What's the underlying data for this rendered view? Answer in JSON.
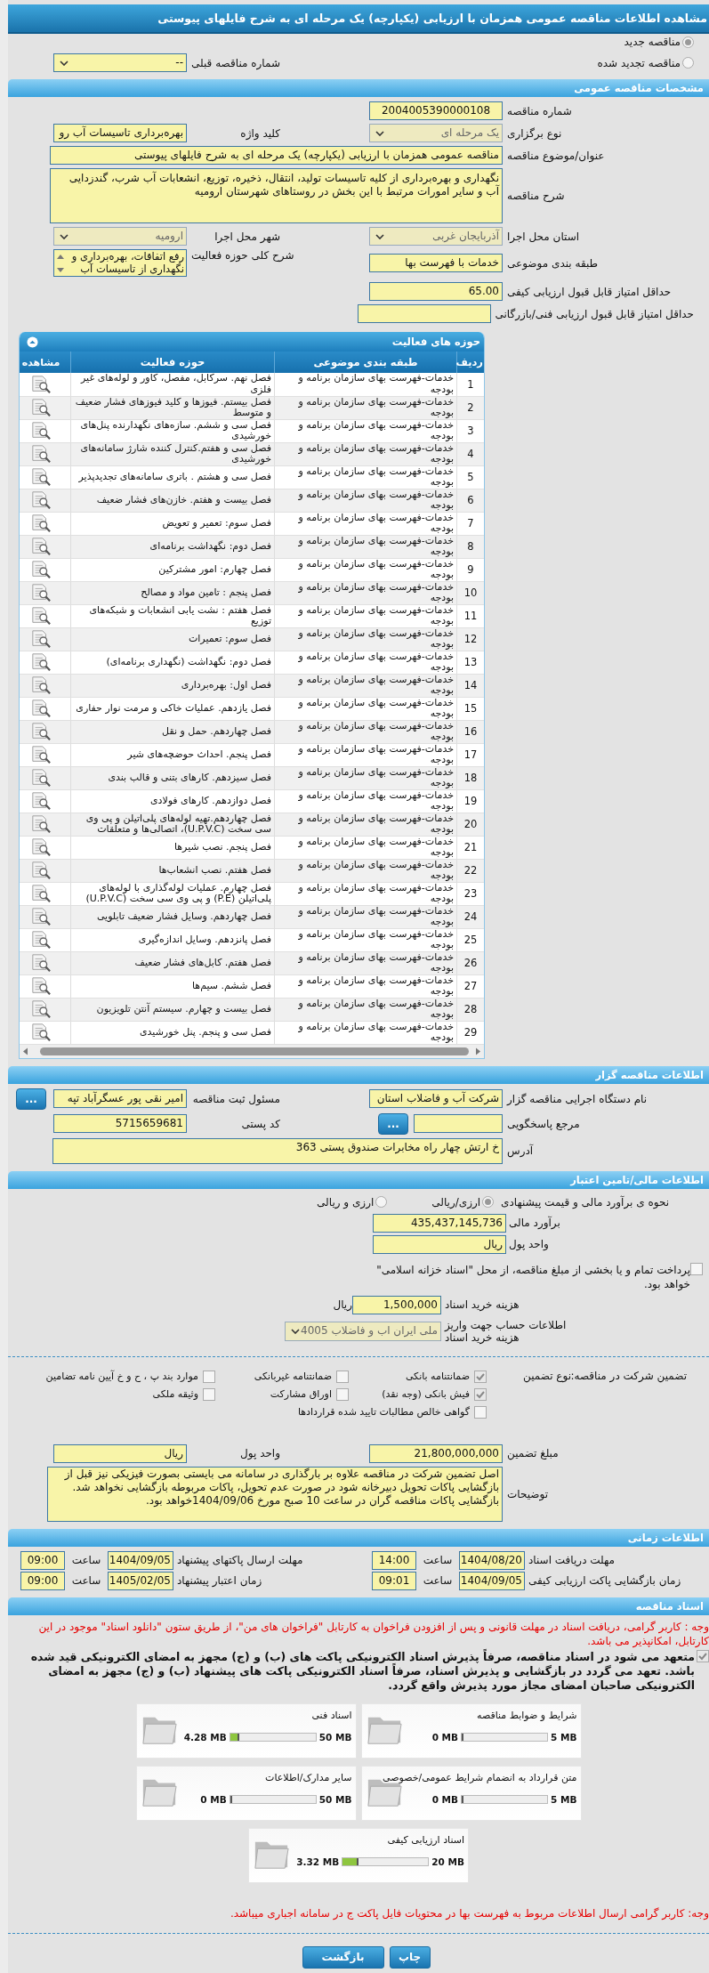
{
  "page_title": "مشاهده اطلاعات مناقصه عمومی همزمان با ارزیابی (یکپارچه) یک مرحله ای به شرح فایلهای پیوستی",
  "tender_type": [
    {
      "label": "مناقصه جدید",
      "selected": true
    },
    {
      "label": "مناقصه تجدید شده",
      "selected": false
    }
  ],
  "previous_tender": {
    "label": "شماره مناقصه قبلی",
    "value": "--"
  },
  "general": {
    "heading": "مشخصات مناقصه عمومی",
    "tender_number": {
      "label": "شماره مناقصه",
      "value": "2004005390000108"
    },
    "holding_type": {
      "label": "نوع برگزاری",
      "value": "یک مرحله ای"
    },
    "keyword": {
      "label": "کلید واژه",
      "value": "بهره‌برداری تاسیسات آب رو"
    },
    "subject": {
      "label": "عنوان/موضوع مناقصه",
      "value": "مناقصه عمومی همزمان با ارزیابی (یکپارچه) یک مرحله ای به شرح فایلهای پیوستی"
    },
    "description": {
      "label": "شرح مناقصه",
      "value": "نگهداری و بهره‌برداری از کلیه تاسیسات تولید، انتقال، ذخیره، توزیع، انشعابات آب شرب، گندزدایی آب و سایر امورات مرتبط با این بخش در روستاهای شهرستان ارومیه"
    },
    "province": {
      "label": "استان محل اجرا",
      "value": "آذربایجان غربی"
    },
    "city": {
      "label": "شهر محل اجرا",
      "value": "ارومیه"
    },
    "classification": {
      "label": "طبقه بندی موضوعی",
      "value": "خدمات با فهرست بها"
    },
    "scope": {
      "label": "شرح کلی حوزه فعالیت",
      "value": "رفع اتفاقات، بهره‌برداری و\nنگهداری از تاسیسات آب"
    },
    "min_quality_score": {
      "label": "حداقل امتیاز قابل قبول ارزیابی کیفی",
      "value": "65.00"
    },
    "min_technical_score": {
      "label": "حداقل امتیاز قابل قبول ارزیابی فنی/بازرگانی"
    }
  },
  "activities": {
    "heading": "حوزه های فعالیت",
    "columns": [
      "ردیف",
      "طبقه بندی موضوعی",
      "حوزه فعالیت",
      "مشاهده"
    ],
    "rows": [
      {
        "index": "1",
        "category": "خدمات-فهرست بهای سازمان برنامه و بودجه",
        "activity": "فصل نهم. سرکابل، مفصل، کاور و لوله‌های غیر فلزی"
      },
      {
        "index": "2",
        "category": "خدمات-فهرست بهای سازمان برنامه و بودجه",
        "activity": "فصل بیستم. فیوزها و کلید فیوزهای فشار ضعیف و متوسط"
      },
      {
        "index": "3",
        "category": "خدمات-فهرست بهای سازمان برنامه و بودجه",
        "activity": "فصل سی و ششم. سازه‌های نگهدارنده پنل‌های خورشیدی"
      },
      {
        "index": "4",
        "category": "خدمات-فهرست بهای سازمان برنامه و بودجه",
        "activity": "فصل سی و هفتم.کنترل کننده شارژ سامانه‌های خورشیدی"
      },
      {
        "index": "5",
        "category": "خدمات-فهرست بهای سازمان برنامه و بودجه",
        "activity": "فصل سی و هشتم . باتری سامانه‌های تجدیدپذیر"
      },
      {
        "index": "6",
        "category": "خدمات-فهرست بهای سازمان برنامه و بودجه",
        "activity": "فصل بیست و هفتم. خازن‌های فشار ضعیف"
      },
      {
        "index": "7",
        "category": "خدمات-فهرست بهای سازمان برنامه و بودجه",
        "activity": "فصل سوم: تعمیر و تعویض"
      },
      {
        "index": "8",
        "category": "خدمات-فهرست بهای سازمان برنامه و بودجه",
        "activity": "فصل دوم: نگهداشت برنامه‌ای"
      },
      {
        "index": "9",
        "category": "خدمات-فهرست بهای سازمان برنامه و بودجه",
        "activity": "فصل چهارم: امور مشترکین"
      },
      {
        "index": "10",
        "category": "خدمات-فهرست بهای سازمان برنامه و بودجه",
        "activity": "فصل پنجم : تامین مواد و مصالح"
      },
      {
        "index": "11",
        "category": "خدمات-فهرست بهای سازمان برنامه و بودجه",
        "activity": "فصل هفتم : نشت یابی انشعابات و شبکه‌های توزیع"
      },
      {
        "index": "12",
        "category": "خدمات-فهرست بهای سازمان برنامه و بودجه",
        "activity": "فصل سوم: تعمیرات"
      },
      {
        "index": "13",
        "category": "خدمات-فهرست بهای سازمان برنامه و بودجه",
        "activity": "فصل دوم: نگهداشت (نگهداری برنامه‌ای)"
      },
      {
        "index": "14",
        "category": "خدمات-فهرست بهای سازمان برنامه و بودجه",
        "activity": "فصل اول: بهره‌برداری"
      },
      {
        "index": "15",
        "category": "خدمات-فهرست بهای سازمان برنامه و بودجه",
        "activity": "فصل یازدهم. عملیات خاکی و مرمت نوار حفاری"
      },
      {
        "index": "16",
        "category": "خدمات-فهرست بهای سازمان برنامه و بودجه",
        "activity": "فصل چهاردهم. حمل و نقل"
      },
      {
        "index": "17",
        "category": "خدمات-فهرست بهای سازمان برنامه و بودجه",
        "activity": "فصل پنجم. احداث حوضچه‌های شیر"
      },
      {
        "index": "18",
        "category": "خدمات-فهرست بهای سازمان برنامه و بودجه",
        "activity": "فصل سیزدهم. کارهای بتنی و قالب بندی"
      },
      {
        "index": "19",
        "category": "خدمات-فهرست بهای سازمان برنامه و بودجه",
        "activity": "فصل دوازدهم. کارهای فولادی"
      },
      {
        "index": "20",
        "category": "خدمات-فهرست بهای سازمان برنامه و بودجه",
        "activity": "فصل چهاردهم.تهیه لوله‌های پلی‌اتیلن و پی وی سی سخت (U.P.V.C)، اتصالی‌ها و متعلقات"
      },
      {
        "index": "21",
        "category": "خدمات-فهرست بهای سازمان برنامه و بودجه",
        "activity": "فصل پنجم. نصب شیرها"
      },
      {
        "index": "22",
        "category": "خدمات-فهرست بهای سازمان برنامه و بودجه",
        "activity": "فصل هفتم. نصب انشعاب‌ها"
      },
      {
        "index": "23",
        "category": "خدمات-فهرست بهای سازمان برنامه و بودجه",
        "activity": "فصل چهارم. عملیات لوله‌گذاری با لوله‌های پلی‌اتیلن (P.E) و پی وی سی سخت (U.P.V.C)"
      },
      {
        "index": "24",
        "category": "خدمات-فهرست بهای سازمان برنامه و بودجه",
        "activity": "فصل چهاردهم. وسایل فشار ضعیف تابلویی"
      },
      {
        "index": "25",
        "category": "خدمات-فهرست بهای سازمان برنامه و بودجه",
        "activity": "فصل پانزدهم. وسایل اندازه‌گیری"
      },
      {
        "index": "26",
        "category": "خدمات-فهرست بهای سازمان برنامه و بودجه",
        "activity": "فصل هفتم. کابل‌های فشار ضعیف"
      },
      {
        "index": "27",
        "category": "خدمات-فهرست بهای سازمان برنامه و بودجه",
        "activity": "فصل ششم. سیم‌ها"
      },
      {
        "index": "28",
        "category": "خدمات-فهرست بهای سازمان برنامه و بودجه",
        "activity": "فصل بیست و چهارم. سیستم آنتن تلویزیون"
      },
      {
        "index": "29",
        "category": "خدمات-فهرست بهای سازمان برنامه و بودجه",
        "activity": "فصل سی و پنجم. پنل خورشیدی"
      }
    ]
  },
  "organizer": {
    "heading": "اطلاعات مناقصه گزار",
    "org_name": {
      "label": "نام دستگاه اجرایی مناقصه گزار",
      "value": "شرکت آب و فاضلاب استان"
    },
    "registrar": {
      "label": "مسئول ثبت مناقصه",
      "value": "امیر نقی پور عسگرآباد تپه",
      "button": "..."
    },
    "responder": {
      "label": "مرجع پاسخگویی",
      "button": "..."
    },
    "postal_code": {
      "label": "کد پستی",
      "value": "5715659681"
    },
    "address": {
      "label": "آدرس",
      "value": "خ ارتش چهار راه مخابرات صندوق پستی 363"
    }
  },
  "financial": {
    "heading": "اطلاعات مالی/تامین اعتبار",
    "estimate_method": {
      "label": "نحوه ی برآورد مالی و قیمت پیشنهادی",
      "options": [
        {
          "label": "ارزی/ریالی",
          "selected": true
        },
        {
          "label": "ارزی و ریالی",
          "selected": false
        }
      ]
    },
    "estimate": {
      "label": "برآورد مالی",
      "value": "435,437,145,736"
    },
    "currency": {
      "label": "واحد پول",
      "value": "ریال"
    },
    "treasury": {
      "label": "پرداخت تمام و یا بخشی از مبلغ مناقصه، از محل \"اسناد خزانه اسلامی\" خواهد بود.",
      "checked": false
    },
    "doc_fee": {
      "label": "هزینه خرید اسناد",
      "value": "1,500,000",
      "unit": "ریال"
    },
    "account": {
      "label": "اطلاعات حساب جهت واریز هزینه خرید اسناد",
      "value": "ملی ایران اب و فاضلاب 4005"
    }
  },
  "guarantee": {
    "title": "تضمین شرکت در مناقصه:",
    "type_label": "نوع تضمین",
    "options": [
      {
        "label": "ضمانتنامه بانکی",
        "checked": true
      },
      {
        "label": "ضمانتنامه غیربانکی",
        "checked": false
      },
      {
        "label": "موارد بند پ ، ح و خ آیین نامه تضامین",
        "checked": false
      },
      {
        "label": "فیش بانکی (وجه نقد)",
        "checked": true
      },
      {
        "label": "اوراق مشارکت",
        "checked": false
      },
      {
        "label": "وثیقه ملکی",
        "checked": false
      },
      {
        "label": "گواهی خالص مطالبات تایید شده قراردادها",
        "checked": false
      }
    ],
    "amount": {
      "label": "مبلغ تضمین",
      "value": "21,800,000,000"
    },
    "currency": {
      "label": "واحد پول",
      "value": "ریال"
    },
    "notes": {
      "label": "توضیحات",
      "value": "اصل تضمین شرکت در مناقصه علاوه بر بارگذاری در سامانه می بایستی بصورت فیزیکی نیز قبل از\nبازگشایی پاکات تحویل دبیرخانه شود در صورت عدم تحویل، پاکات مربوطه بازگشایی نخواهد شد.\nبازگشایی پاکات مناقصه گران در ساعت 10 صبح مورخ 1404/09/06خواهد بود."
    }
  },
  "timing": {
    "heading": "اطلاعات زمانی",
    "items": [
      {
        "label": "مهلت دریافت اسناد",
        "date": "1404/08/20",
        "time_label": "ساعت",
        "time": "14:00"
      },
      {
        "label": "مهلت ارسال پاکتهای پیشنهاد",
        "date": "1404/09/05",
        "time_label": "ساعت",
        "time": "09:00"
      },
      {
        "label": "زمان بازگشایی پاکت ارزیابی کیفی",
        "date": "1404/09/05",
        "time_label": "ساعت",
        "time": "09:01"
      },
      {
        "label": "زمان اعتبار پیشنهاد",
        "date": "1405/02/05",
        "time_label": "ساعت",
        "time": "09:00"
      }
    ]
  },
  "documents": {
    "heading": "اسناد مناقصه",
    "notice": "وجه : کاربر گرامی، دریافت اسناد در مهلت قانونی و پس از افزودن فراخوان به کارتابل \"فراخوان های من\"، از طریق ستون \"دانلود اسناد\" موجود در این کارتابل، امکانپذیر می باشد.",
    "commitment": {
      "text": "متعهد می شود در اسناد مناقصه، صرفاً پذیرش اسناد الکترونیکی پاکت های (ب) و (ج) مجهز به امضای الکترونیکی قید شده باشد. تعهد می گردد در بازگشایی و پذیرش اسناد، صرفاً اسناد الکترونیکی پاکت های پیشنهاد (ب) و (ج) مجهز به امضای الکترونیکی صاحبان امضای مجاز مورد پذیرش واقع گردد.",
      "checked": true
    },
    "files": [
      {
        "name": "شرایط و ضوابط مناقصه",
        "max": "5 MB",
        "used": "0 MB",
        "level": 0
      },
      {
        "name": "اسناد فنی",
        "max": "50 MB",
        "used": "4.28 MB",
        "level": 0.086
      },
      {
        "name": "متن قرارداد به انضمام شرایط عمومی/خصوصی",
        "max": "5 MB",
        "used": "0 MB",
        "level": 0
      },
      {
        "name": "سایر مدارک/اطلاعات",
        "max": "50 MB",
        "used": "0 MB",
        "level": 0
      },
      {
        "name": "اسناد ارزیابی کیفی",
        "max": "20 MB",
        "used": "3.32 MB",
        "level": 0.166
      }
    ],
    "footer_notice": "وجه: کاربر گرامی ارسال اطلاعات مربوط به فهرست بها در محتویات فایل پاکت ج در سامانه اجباری میباشد."
  },
  "buttons": [
    "چاپ",
    "بازگشت"
  ]
}
